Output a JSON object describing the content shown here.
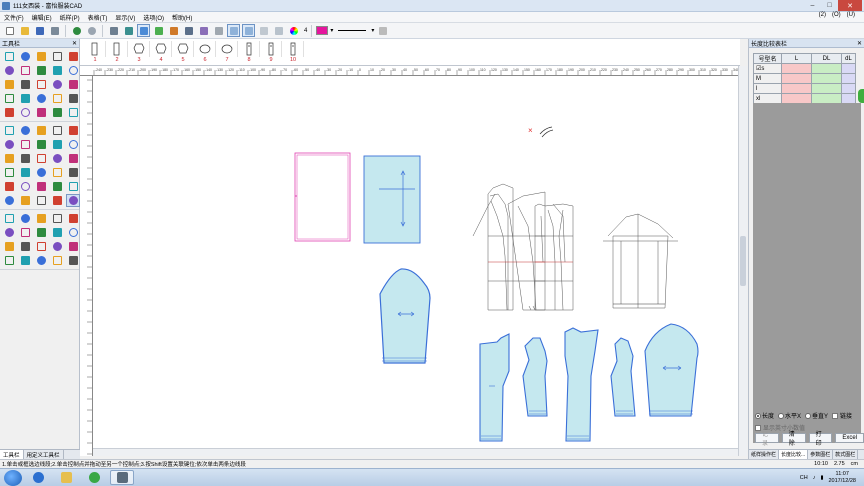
{
  "window": {
    "title": "111女西装 - 富怡服装CAD",
    "controls": [
      "–",
      "□",
      "✕"
    ]
  },
  "menu": {
    "items": [
      "文件(F)",
      "编辑(E)",
      "纸样(P)",
      "表格(T)",
      "显示(V)",
      "选项(O)",
      "帮助(H)"
    ],
    "right": [
      "(2)",
      "(O)",
      "(U)"
    ]
  },
  "toolbar": {
    "spin_value": "4",
    "accent_color": "#e5159e"
  },
  "left_panel": {
    "title": "工具栏",
    "close": "✕",
    "tabs": [
      "工具栏",
      "用定义工具栏"
    ]
  },
  "size_bar": {
    "numbers": [
      "1",
      "2",
      "3",
      "4",
      "5",
      "6",
      "7",
      "8",
      "9",
      "10"
    ]
  },
  "hruler": {
    "labels": [
      "-240",
      "-230",
      "-220",
      "-210",
      "-200",
      "-190",
      "-180",
      "-170",
      "-160",
      "-150",
      "-140",
      "-130",
      "-120",
      "-110",
      "-100",
      "-90",
      "-80",
      "-70",
      "-60",
      "-50",
      "-40",
      "-30",
      "-20",
      "-10",
      "0",
      "10",
      "20",
      "30",
      "40",
      "50",
      "60",
      "70",
      "80",
      "90",
      "100",
      "110",
      "120",
      "130",
      "140",
      "150",
      "160",
      "170",
      "180",
      "190",
      "200",
      "210",
      "220",
      "230",
      "240",
      "250",
      "260",
      "270",
      "280",
      "290",
      "300",
      "310",
      "320",
      "330",
      "340",
      "350"
    ]
  },
  "right_panel": {
    "title": "长度比较表栏",
    "close": "✕",
    "table": {
      "headers": [
        "号型名",
        "L",
        "DL",
        "dL"
      ],
      "rows": [
        {
          "name": "s",
          "checked": true
        },
        {
          "name": "M",
          "checked": false
        },
        {
          "name": "l",
          "checked": false
        },
        {
          "name": "xl",
          "checked": false
        }
      ]
    },
    "radio_options": [
      {
        "label": "长度",
        "selected": true
      },
      {
        "label": "水平X",
        "selected": false
      },
      {
        "label": "垂直Y",
        "selected": false
      },
      {
        "label": "链接",
        "selected": false
      }
    ],
    "show_scale_label": "显示英寸小数值",
    "buttons": [
      {
        "label": "记录",
        "disabled": true
      },
      {
        "label": "清除",
        "disabled": false
      },
      {
        "label": "打印",
        "disabled": false
      },
      {
        "label": "Excel",
        "disabled": false
      }
    ],
    "tabs": [
      "纸样操作栏",
      "长度比较...",
      "参数图栏",
      "款式图栏"
    ]
  },
  "status": {
    "message": "1.单击或框选边线段;2.单击控制点并拖动至另一个控制点;3.按Shift设置关联键位;依次单击两条边线段",
    "coord_a": "10:10",
    "coord_b": "2.75",
    "unit": "cm"
  },
  "taskbar": {
    "time": "11:07",
    "date": "2017/12/28",
    "lang": "CH"
  },
  "canvas": {
    "marker": "×",
    "piece_color_outline": "#e040b0",
    "piece_fill": "#c5e8ef",
    "piece_stroke": "#3a6fd8"
  }
}
